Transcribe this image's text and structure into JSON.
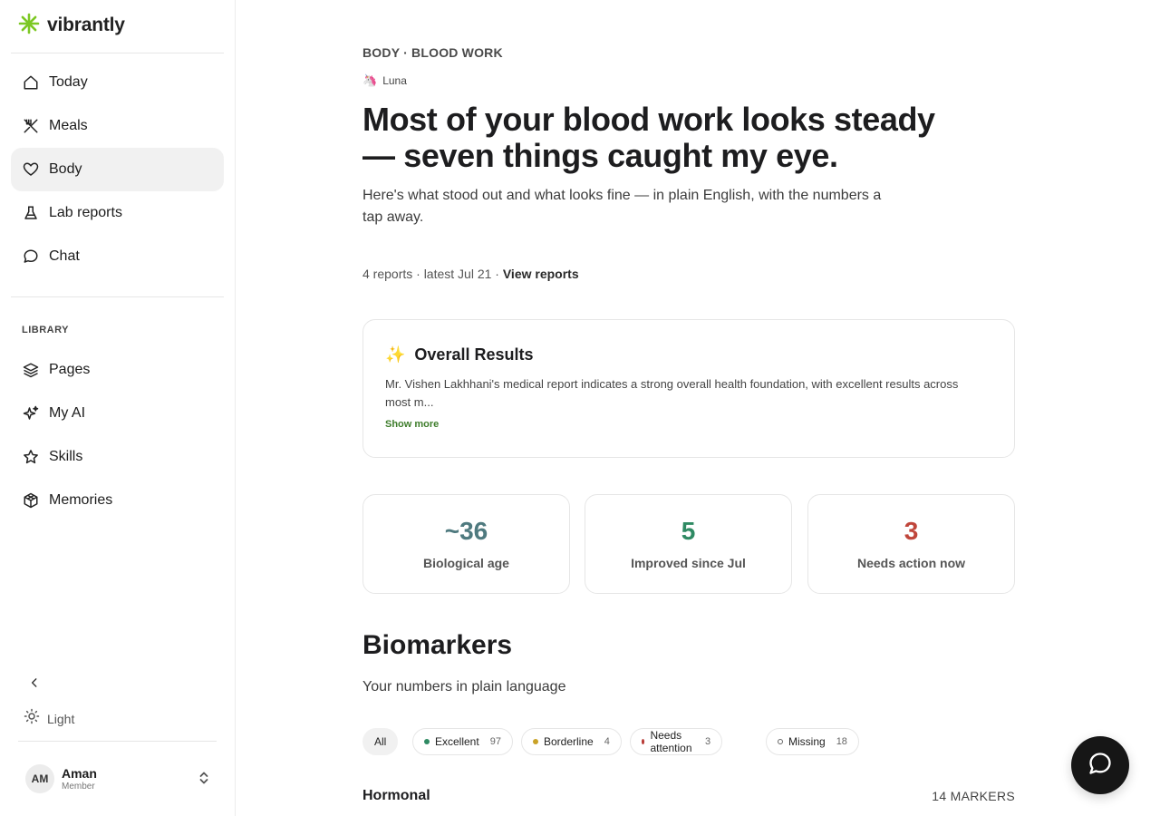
{
  "app": {
    "name": "vibrantly",
    "accent": "#3e7d2b",
    "brand_color": "#7cc823"
  },
  "sidebar": {
    "nav": [
      {
        "label": "Today",
        "icon": "home-icon"
      },
      {
        "label": "Meals",
        "icon": "utensils-icon"
      },
      {
        "label": "Body",
        "icon": "heart-icon",
        "active": true
      },
      {
        "label": "Lab reports",
        "icon": "flask-icon"
      },
      {
        "label": "Chat",
        "icon": "chat-bubble-icon"
      }
    ],
    "library_label": "LIBRARY",
    "library": [
      {
        "label": "Pages",
        "icon": "layers-icon"
      },
      {
        "label": "My AI",
        "icon": "sparkles-icon"
      },
      {
        "label": "Skills",
        "icon": "star-icon"
      },
      {
        "label": "Memories",
        "icon": "cube-icon"
      }
    ],
    "theme_label": "Light",
    "user": {
      "initials": "AM",
      "name": "Aman",
      "role": "Member"
    }
  },
  "main": {
    "breadcrumb": "BODY · BLOOD WORK",
    "author": "Luna",
    "headline": "Most of your blood work looks steady — seven things caught my eye.",
    "subhead": "Here's what stood out and what looks fine — in plain English, with the numbers a tap away.",
    "meta": {
      "reports": "4 reports · latest Jul 21 ·",
      "link": "View reports"
    },
    "summary": {
      "emoji": "✨",
      "title": "Overall Results",
      "text": "Mr. Vishen Lakhhani's medical report indicates a strong overall health foundation, with excellent results across most m...",
      "show_more": "Show more"
    },
    "stats": [
      {
        "value": "~36",
        "caption": "Biological age",
        "color": "#4f7a7f"
      },
      {
        "value": "5",
        "caption": "Improved since Jul",
        "color": "#2f8a63"
      },
      {
        "value": "3",
        "caption": "Needs action now",
        "color": "#c0463b"
      }
    ],
    "biomarkers": {
      "title": "Biomarkers",
      "subtitle": "Your numbers in plain language",
      "filters": [
        {
          "label": "All",
          "active": true
        },
        {
          "label": "Excellent",
          "count": "97",
          "color": "#2f8a63"
        },
        {
          "label": "Borderline",
          "count": "4",
          "color": "#c9a227"
        },
        {
          "label": "Needs attention",
          "count": "3",
          "color": "#b83a36"
        },
        {
          "label": "Missing",
          "count": "18",
          "color": "#666666",
          "ring": true
        }
      ],
      "group": {
        "name": "Hormonal",
        "count": "14 MARKERS"
      }
    }
  }
}
